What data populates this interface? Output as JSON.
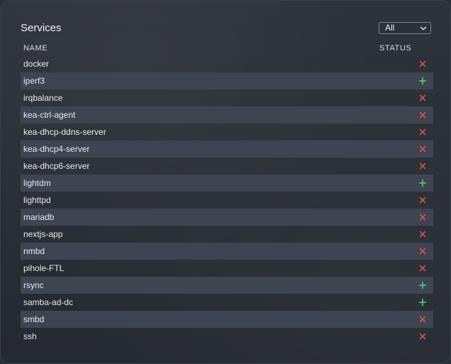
{
  "panel": {
    "title": "Services",
    "filter": {
      "selected": "All"
    },
    "columns": {
      "name": "NAME",
      "status": "STATUS"
    },
    "colors": {
      "running": "#5fd07a",
      "stopped": "#e2574c"
    }
  },
  "services": [
    {
      "name": "docker",
      "status": "stopped"
    },
    {
      "name": "iperf3",
      "status": "running"
    },
    {
      "name": "irqbalance",
      "status": "stopped"
    },
    {
      "name": "kea-ctrl-agent",
      "status": "stopped"
    },
    {
      "name": "kea-dhcp-ddns-server",
      "status": "stopped"
    },
    {
      "name": "kea-dhcp4-server",
      "status": "stopped"
    },
    {
      "name": "kea-dhcp6-server",
      "status": "stopped"
    },
    {
      "name": "lightdm",
      "status": "running"
    },
    {
      "name": "lighttpd",
      "status": "stopped"
    },
    {
      "name": "mariadb",
      "status": "stopped"
    },
    {
      "name": "nextjs-app",
      "status": "stopped"
    },
    {
      "name": "nmbd",
      "status": "stopped"
    },
    {
      "name": "pihole-FTL",
      "status": "stopped"
    },
    {
      "name": "rsync",
      "status": "running"
    },
    {
      "name": "samba-ad-dc",
      "status": "running"
    },
    {
      "name": "smbd",
      "status": "stopped"
    },
    {
      "name": "ssh",
      "status": "stopped"
    }
  ]
}
